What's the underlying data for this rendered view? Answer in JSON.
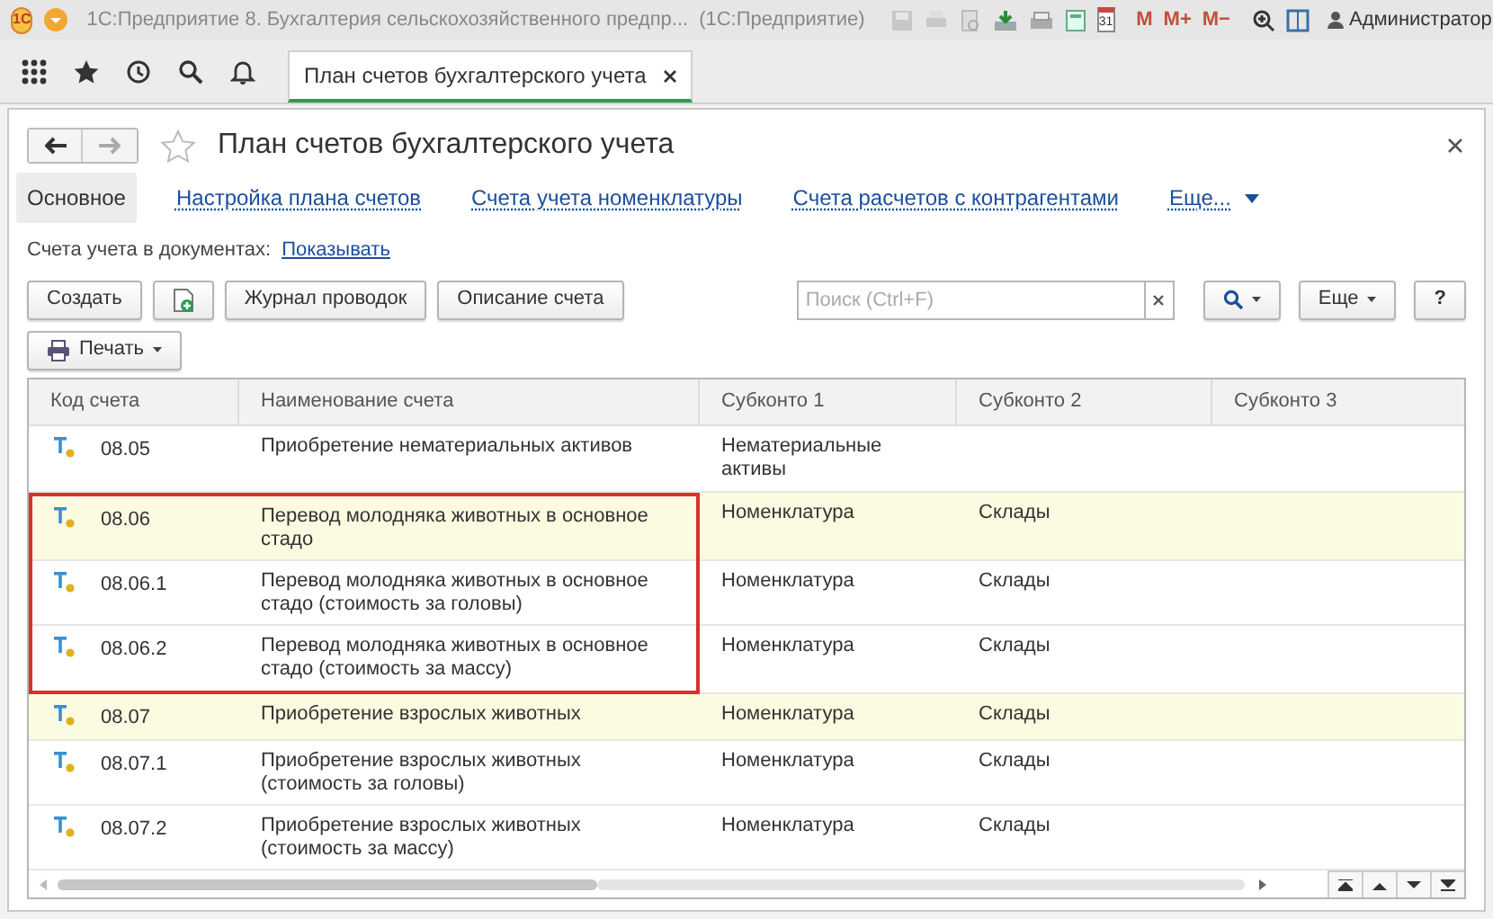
{
  "title_bar": {
    "logo": "1С",
    "title": "1С:Предприятие 8. Бухгалтерия сельскохозяйственного предпр...",
    "app_name": "(1С:Предприятие)",
    "calendar_day": "31",
    "memory_buttons": [
      "M",
      "M+",
      "M−"
    ],
    "user": "Администратор"
  },
  "open_tabs": [
    {
      "label": "План счетов бухгалтерского учета",
      "selected": true
    }
  ],
  "form": {
    "title": "План счетов бухгалтерского учета",
    "nav_links": [
      {
        "label": "Основное",
        "selected": true
      },
      {
        "label": "Настройка плана счетов",
        "selected": false
      },
      {
        "label": "Счета учета номенклатуры",
        "selected": false
      },
      {
        "label": "Счета расчетов с контрагентами",
        "selected": false
      },
      {
        "label": "Еще...",
        "selected": false
      }
    ],
    "setting_label": "Счета учета в документах:",
    "setting_link": "Показывать",
    "buttons": [
      "Создать",
      "Журнал проводок",
      "Описание счета"
    ],
    "search": {
      "placeholder": "Поиск (Ctrl+F)"
    },
    "more_button": "Еще",
    "help_button": "?",
    "print_button": "Печать"
  },
  "table": {
    "columns": [
      "Код счета",
      "Наименование счета",
      "Субконто 1",
      "Субконто 2",
      "Субконто 3"
    ],
    "rows": [
      {
        "code": "08.05",
        "name": "Приобретение нематериальных активов",
        "sub1": "Нематериальные активы",
        "sub2": "",
        "highlighted": false,
        "framed": false
      },
      {
        "code": "08.06",
        "name": "Перевод молодняка животных в основное стадо",
        "sub1": "Номенклатура",
        "sub2": "Склады",
        "highlighted": true,
        "framed": true
      },
      {
        "code": "08.06.1",
        "name": "Перевод молодняка животных в основное стадо (стоимость за головы)",
        "sub1": "Номенклатура",
        "sub2": "Склады",
        "highlighted": false,
        "framed": true
      },
      {
        "code": "08.06.2",
        "name": "Перевод молодняка животных в основное стадо (стоимость за массу)",
        "sub1": "Номенклатура",
        "sub2": "Склады",
        "highlighted": false,
        "framed": true
      },
      {
        "code": "08.07",
        "name": "Приобретение взрослых животных",
        "sub1": "Номенклатура",
        "sub2": "Склады",
        "highlighted": true,
        "framed": false
      },
      {
        "code": "08.07.1",
        "name": "Приобретение взрослых животных (стоимость за головы)",
        "sub1": "Номенклатура",
        "sub2": "Склады",
        "highlighted": false,
        "framed": false
      },
      {
        "code": "08.07.2",
        "name": "Приобретение взрослых животных (стоимость за массу)",
        "sub1": "Номенклатура",
        "sub2": "Склады",
        "highlighted": false,
        "framed": false
      }
    ]
  }
}
